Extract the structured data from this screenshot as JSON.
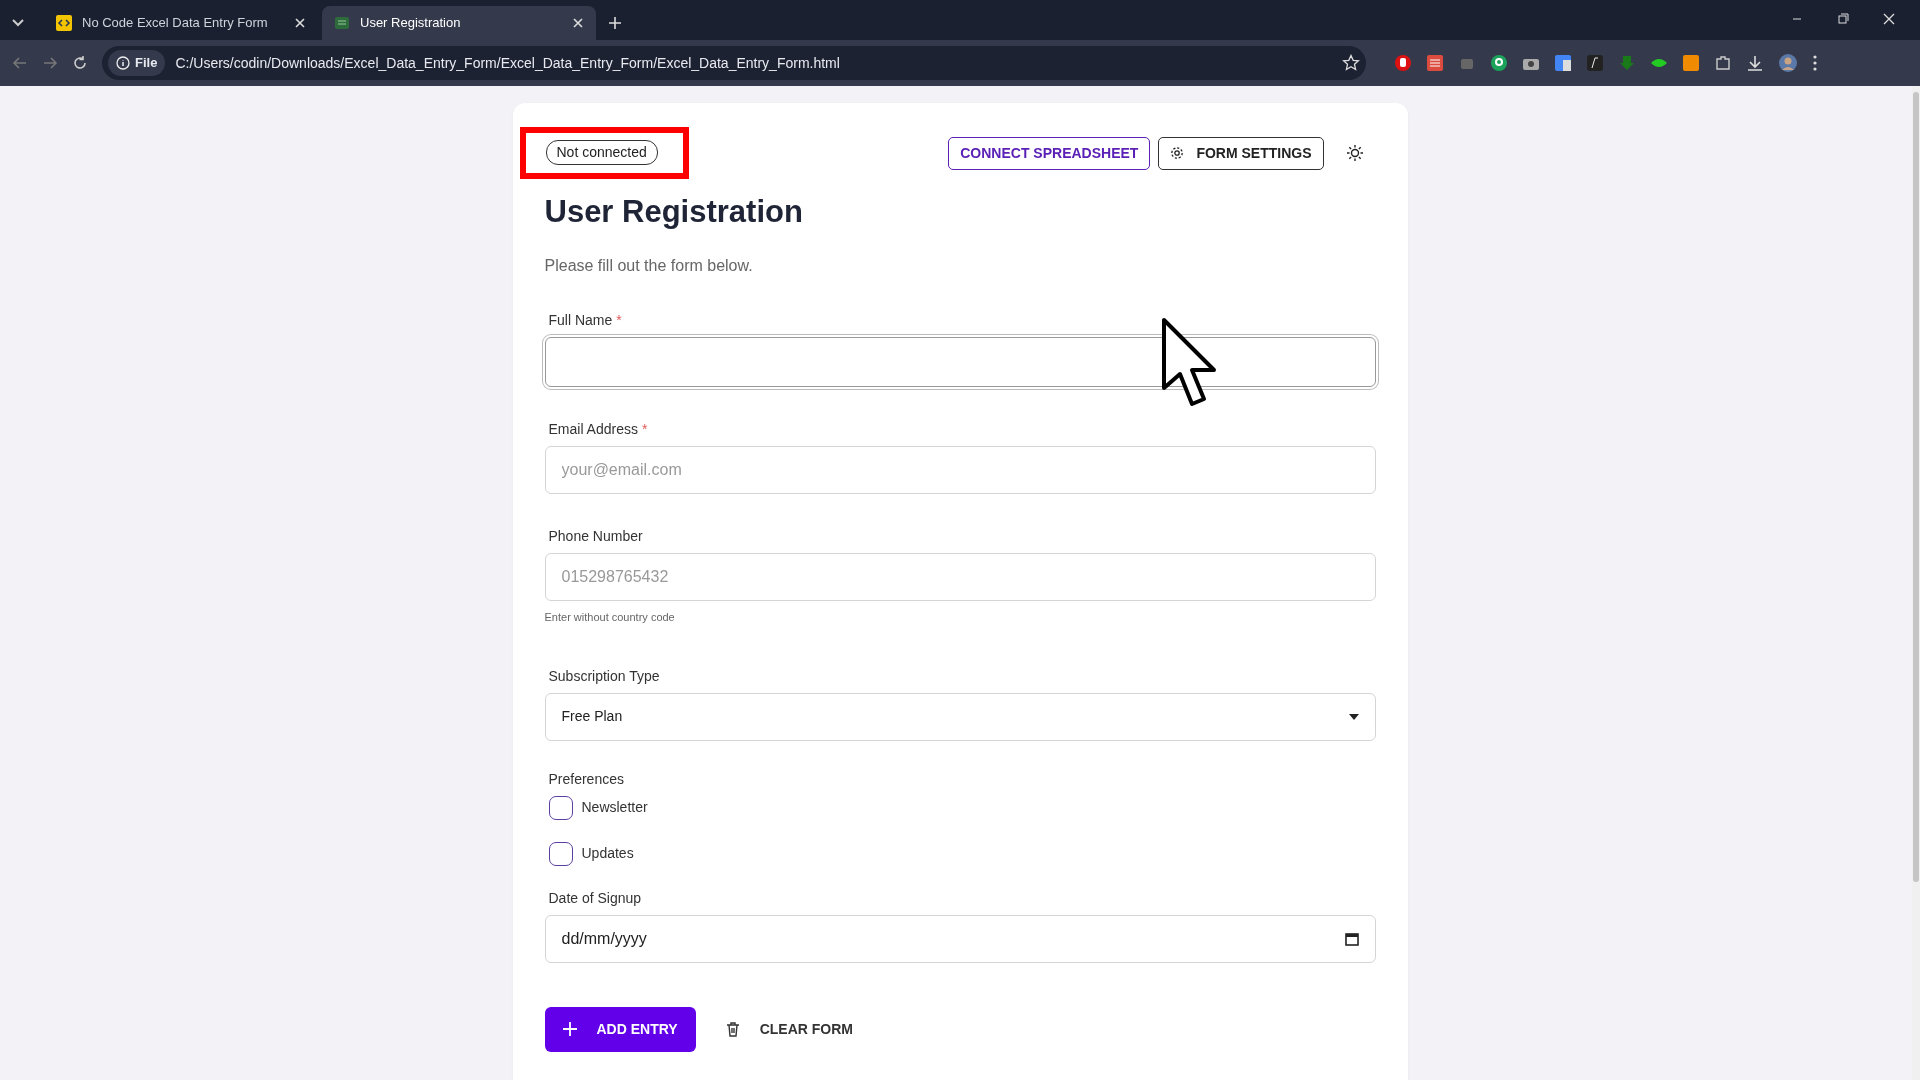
{
  "browser": {
    "tabs": [
      {
        "title": "No Code Excel Data Entry Form",
        "selected": false
      },
      {
        "title": "User Registration",
        "selected": true
      }
    ],
    "address": {
      "scheme": "File",
      "url": "C:/Users/codin/Downloads/Excel_Data_Entry_Form/Excel_Data_Entry_Form/Excel_Data_Entry_Form.html"
    }
  },
  "form": {
    "status_badge": {
      "text": "Not connected",
      "highlighted": true
    },
    "header_buttons": [
      {
        "label": "CONNECT SPREADSHEET",
        "kind": "outline-accent"
      },
      {
        "label": "FORM SETTINGS",
        "kind": "settings"
      }
    ],
    "title": "User Registration",
    "subtitle": "Please fill out the form below.",
    "fields": [
      {
        "kind": "text",
        "label": "Full Name",
        "required_mark": "*",
        "focused": true
      },
      {
        "kind": "email",
        "label": "Email Address",
        "required_mark": "*",
        "placeholder": "your@email.com"
      },
      {
        "kind": "tel",
        "label": "Phone Number",
        "placeholder": "015298765432",
        "help": "Enter without country code"
      },
      {
        "kind": "select",
        "label": "Subscription Type",
        "value": "Free Plan"
      },
      {
        "kind": "checkboxes",
        "label": "Preferences",
        "options": [
          {
            "label": "Newsletter",
            "checked": false
          },
          {
            "label": "Updates",
            "checked": false
          }
        ]
      },
      {
        "kind": "date",
        "label": "Date of Signup",
        "placeholder": "dd/mm/yyyy"
      }
    ],
    "actions": [
      {
        "label": "ADD ENTRY",
        "kind": "primary"
      },
      {
        "label": "CLEAR FORM",
        "kind": "clear"
      }
    ]
  }
}
